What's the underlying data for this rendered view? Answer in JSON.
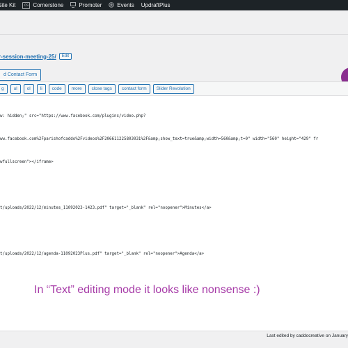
{
  "adminbar": {
    "items": [
      {
        "icon": "site-kit-icon",
        "label": "Site Kit"
      },
      {
        "icon": "cornerstone-icon",
        "label": "Cornerstone"
      },
      {
        "icon": "promoter-icon",
        "label": "Promoter"
      },
      {
        "icon": "events-icon",
        "label": "Events"
      },
      {
        "icon": "",
        "label": "UpdraftPlus"
      }
    ]
  },
  "permalink": {
    "slug": "r-session-meeting-25/",
    "edit_label": "Edit"
  },
  "add_contact_form_label": "d Contact Form",
  "quicktags": [
    "g",
    "ul",
    "ol",
    "li",
    "code",
    "more",
    "close tags",
    "contact form",
    "Slider Revolution"
  ],
  "code_lines": [
    "w: hidden;\" src=\"https://www.facebook.com/plugins/video.php?",
    "ww.facebook.com%2Fparishofcaddo%2Fvideos%2F206611225803031%2F&amp;show_text=true&amp;width=560&amp;t=0\" width=\"560\" height=\"429\" fr",
    "wfullscreen\"></iframe>",
    "",
    "t/uploads/2022/12/minutes_11092023-1423.pdf\" target=\"_blank\" rel=\"noopener\">Minutes</a>",
    "",
    "t/uploads/2022/12/agenda-11092023Plus.pdf\" target=\"_blank\" rel=\"noopener\">Agenda</a>"
  ],
  "caption": "In “Text” editing mode it looks like nonsense :)",
  "last_edited": "Last edited by caddocreative on January",
  "colors": {
    "caption": "#a73ca8",
    "link": "#2271b1",
    "adminbar": "#1d2327"
  }
}
